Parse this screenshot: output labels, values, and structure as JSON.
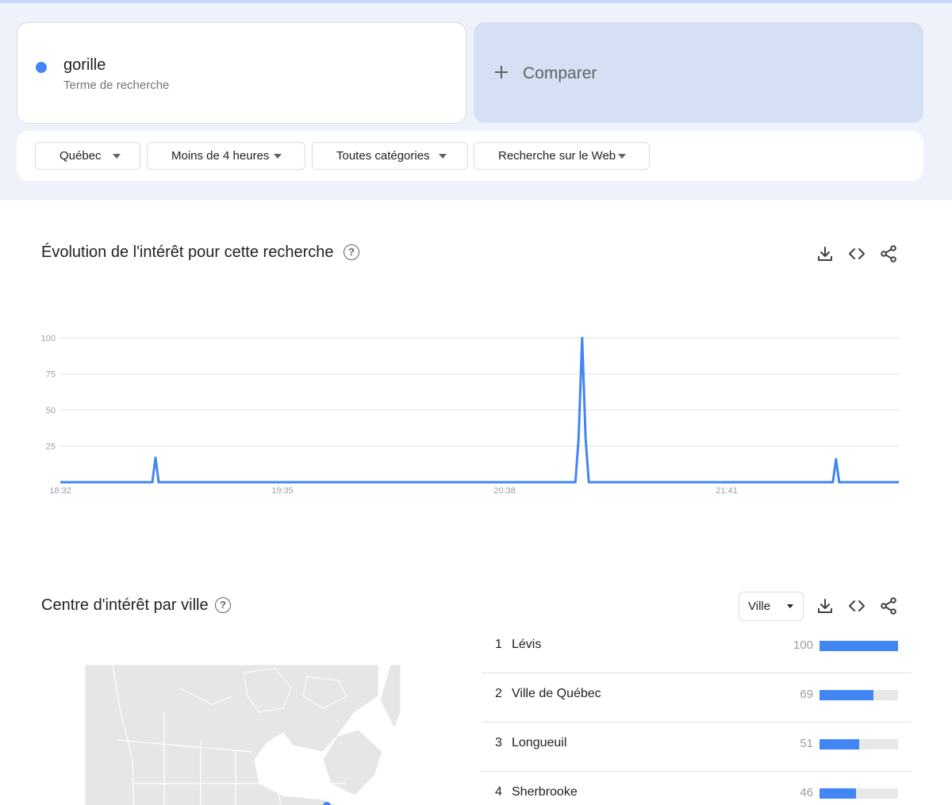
{
  "search_term": {
    "name": "gorille",
    "subtitle": "Terme de recherche",
    "color": "#4285f4"
  },
  "compare": {
    "label": "Comparer"
  },
  "filters": {
    "region": "Québec",
    "time": "Moins de 4 heures",
    "category": "Toutes catégories",
    "property": "Recherche sur le Web"
  },
  "interest_card": {
    "title": "Évolution de l'intérêt pour cette recherche",
    "help": "?"
  },
  "chart_data": {
    "type": "line",
    "title": "Évolution de l'intérêt pour cette recherche",
    "xlabel": "",
    "ylabel": "",
    "ylim": [
      0,
      100
    ],
    "yticks": [
      25,
      50,
      75,
      100
    ],
    "xtick_labels": [
      "18:32",
      "19:35",
      "20:38",
      "21:41"
    ],
    "grid": true,
    "color": "#4285f4",
    "series": [
      {
        "values": [
          0,
          0,
          0,
          0,
          0,
          0,
          0,
          0,
          0,
          0,
          0,
          0,
          0,
          0,
          0,
          0,
          0,
          0,
          0,
          0,
          0,
          0,
          0,
          0,
          0,
          0,
          0,
          0,
          0,
          0,
          0,
          0,
          0,
          0,
          0,
          0,
          0,
          0,
          0,
          0,
          0,
          0,
          0,
          0,
          0,
          0,
          0,
          0,
          0,
          0,
          0,
          0,
          0,
          0,
          0,
          0,
          0,
          0,
          0,
          0,
          0,
          0,
          0,
          0,
          0,
          0,
          0,
          0,
          0,
          0,
          0,
          0,
          0,
          0,
          0,
          0,
          0,
          0,
          0,
          0,
          0,
          0,
          0,
          0,
          0,
          0,
          0,
          0,
          0,
          0,
          0,
          0,
          0,
          0,
          0,
          0,
          0,
          0,
          0,
          0,
          0,
          0,
          0,
          0,
          0,
          0,
          0,
          0,
          0,
          0,
          0,
          0,
          0,
          0,
          0,
          0,
          0,
          0,
          0,
          0,
          0,
          0,
          0,
          0,
          0,
          0,
          0,
          0,
          0,
          0,
          0,
          0,
          0,
          0,
          0,
          0,
          0,
          0,
          0,
          0,
          0,
          0,
          0,
          0,
          0,
          0,
          0,
          0,
          0,
          0,
          0,
          0,
          0,
          0,
          0,
          0,
          0,
          0,
          0,
          0,
          0,
          0,
          0,
          0,
          0,
          0,
          0,
          0,
          0,
          0,
          0,
          0,
          0,
          0,
          0,
          0,
          0,
          0,
          0,
          0,
          0,
          0,
          0,
          0,
          0,
          0,
          0,
          0,
          0,
          0,
          0,
          0,
          0,
          0,
          0,
          0,
          0,
          0,
          0,
          0,
          0,
          0,
          0,
          0,
          0,
          0,
          0,
          0,
          0,
          0,
          0,
          0,
          0,
          0,
          0,
          0,
          0,
          0,
          0,
          0,
          0,
          0,
          0,
          0,
          0,
          0,
          0,
          0,
          0,
          0,
          0,
          0,
          0,
          0,
          0,
          0,
          0,
          0,
          0,
          0
        ]
      }
    ],
    "peaks": [
      {
        "x": "18:59",
        "value": 17
      },
      {
        "x": "20:59",
        "value": 30
      },
      {
        "x": "21:00",
        "value": 100
      },
      {
        "x": "21:01",
        "value": 30
      },
      {
        "x": "22:12",
        "value": 16
      }
    ]
  },
  "city_card": {
    "title": "Centre d'intérêt par ville",
    "help": "?",
    "select_value": "Ville"
  },
  "cities": [
    {
      "rank": "1",
      "name": "Lévis",
      "value": 100
    },
    {
      "rank": "2",
      "name": "Ville de Québec",
      "value": 69
    },
    {
      "rank": "3",
      "name": "Longueuil",
      "value": 51
    },
    {
      "rank": "4",
      "name": "Sherbrooke",
      "value": 46
    }
  ]
}
